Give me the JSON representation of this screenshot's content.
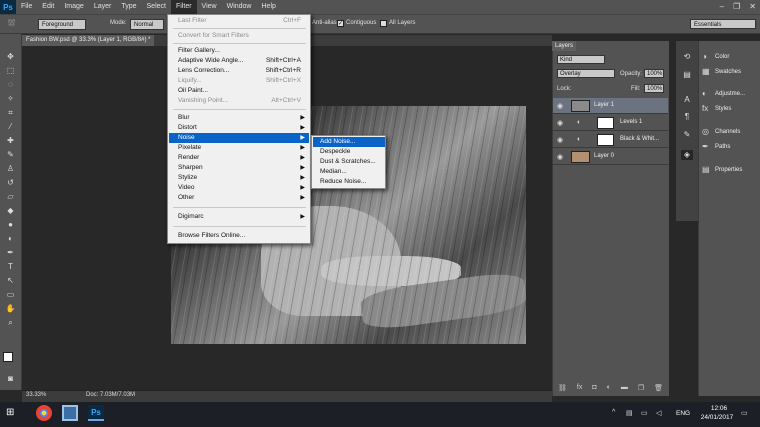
{
  "menubar": {
    "logo": "Ps",
    "items": [
      "File",
      "Edit",
      "Image",
      "Layer",
      "Type",
      "Select",
      "Filter",
      "View",
      "Window",
      "Help"
    ],
    "active": "Filter",
    "window_controls": [
      "–",
      "❐",
      "✕"
    ]
  },
  "options_bar": {
    "foreground": "Foreground",
    "mode_label": "Mode:",
    "mode_value": "Normal",
    "antialias": "Anti-alias",
    "contiguous": "Contiguous",
    "all_layers": "All Layers",
    "workspace": "Essentials"
  },
  "document": {
    "tab_title": "Fashion BW.psd @ 33.3% (Layer 1, RGB/8#) *",
    "zoom": "33.33%",
    "doc_size": "Doc: 7.03M/7.03M"
  },
  "filter_menu": {
    "items": [
      {
        "label": "Last Filter",
        "shortcut": "Ctrl+F",
        "disabled": true
      },
      {
        "label": "Convert for Smart Filters",
        "disabled": true
      },
      {
        "label": "Filter Gallery..."
      },
      {
        "label": "Adaptive Wide Angle...",
        "shortcut": "Shift+Ctrl+A"
      },
      {
        "label": "Lens Correction...",
        "shortcut": "Shift+Ctrl+R"
      },
      {
        "label": "Liquify...",
        "shortcut": "Shift+Ctrl+X",
        "disabled": true
      },
      {
        "label": "Oil Paint..."
      },
      {
        "label": "Vanishing Point...",
        "shortcut": "Alt+Ctrl+V",
        "disabled": true
      },
      {
        "label": "Blur"
      },
      {
        "label": "Distort"
      },
      {
        "label": "Noise",
        "highlighted": true
      },
      {
        "label": "Pixelate"
      },
      {
        "label": "Render"
      },
      {
        "label": "Sharpen"
      },
      {
        "label": "Stylize"
      },
      {
        "label": "Video"
      },
      {
        "label": "Other"
      },
      {
        "label": "Digimarc"
      },
      {
        "label": "Browse Filters Online..."
      }
    ]
  },
  "noise_menu": {
    "items": [
      "Add Noise...",
      "Despeckle",
      "Dust & Scratches...",
      "Median...",
      "Reduce Noise..."
    ],
    "highlighted": "Add Noise..."
  },
  "layers_panel": {
    "tab": "Layers",
    "kind": "Kind",
    "blend_mode": "Overlay",
    "opacity_label": "Opacity:",
    "opacity": "100%",
    "lock_label": "Lock:",
    "fill_label": "Fill:",
    "fill": "100%",
    "layers": [
      {
        "name": "Layer 1",
        "selected": true
      },
      {
        "name": "Levels 1"
      },
      {
        "name": "Black & Whit..."
      },
      {
        "name": "Layer 0"
      }
    ],
    "footer_icons": [
      "link-icon",
      "fx-icon",
      "mask-icon",
      "adjustment-icon",
      "folder-icon",
      "new-layer-icon",
      "trash-icon"
    ]
  },
  "dock": {
    "panels": [
      "Color",
      "Swatches",
      "Adjustme...",
      "Styles",
      "Channels",
      "Paths",
      "Properties"
    ]
  },
  "taskbar": {
    "lang": "ENG",
    "time": "12:06",
    "date": "24/01/2017"
  },
  "colors": {
    "highlight": "#0a64c8",
    "selected_layer": "#6b7381"
  }
}
